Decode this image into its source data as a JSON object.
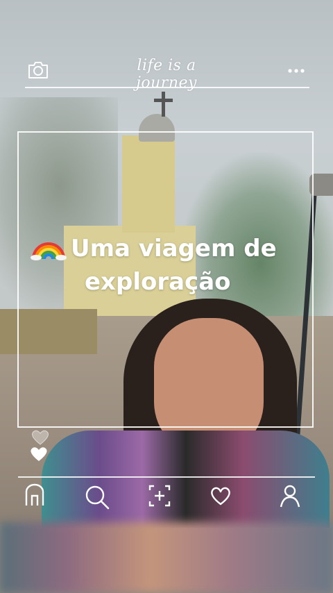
{
  "header": {
    "title": "life is a journey",
    "left_icon": "camera-icon",
    "right_icon": "more-dots-icon"
  },
  "post": {
    "caption_emoji": "rainbow-icon",
    "caption_line1": "Uma viagem de",
    "caption_line2": "exploração"
  },
  "reactions": {
    "icons": [
      "heart-outline-icon",
      "heart-filled-icon"
    ]
  },
  "bottom_nav": {
    "items": [
      {
        "name": "home",
        "icon": "home-arch-icon"
      },
      {
        "name": "search",
        "icon": "search-icon"
      },
      {
        "name": "add",
        "icon": "add-post-icon"
      },
      {
        "name": "likes",
        "icon": "heart-icon"
      },
      {
        "name": "profile",
        "icon": "profile-icon"
      }
    ]
  },
  "colors": {
    "overlay_white": "#ffffff"
  }
}
